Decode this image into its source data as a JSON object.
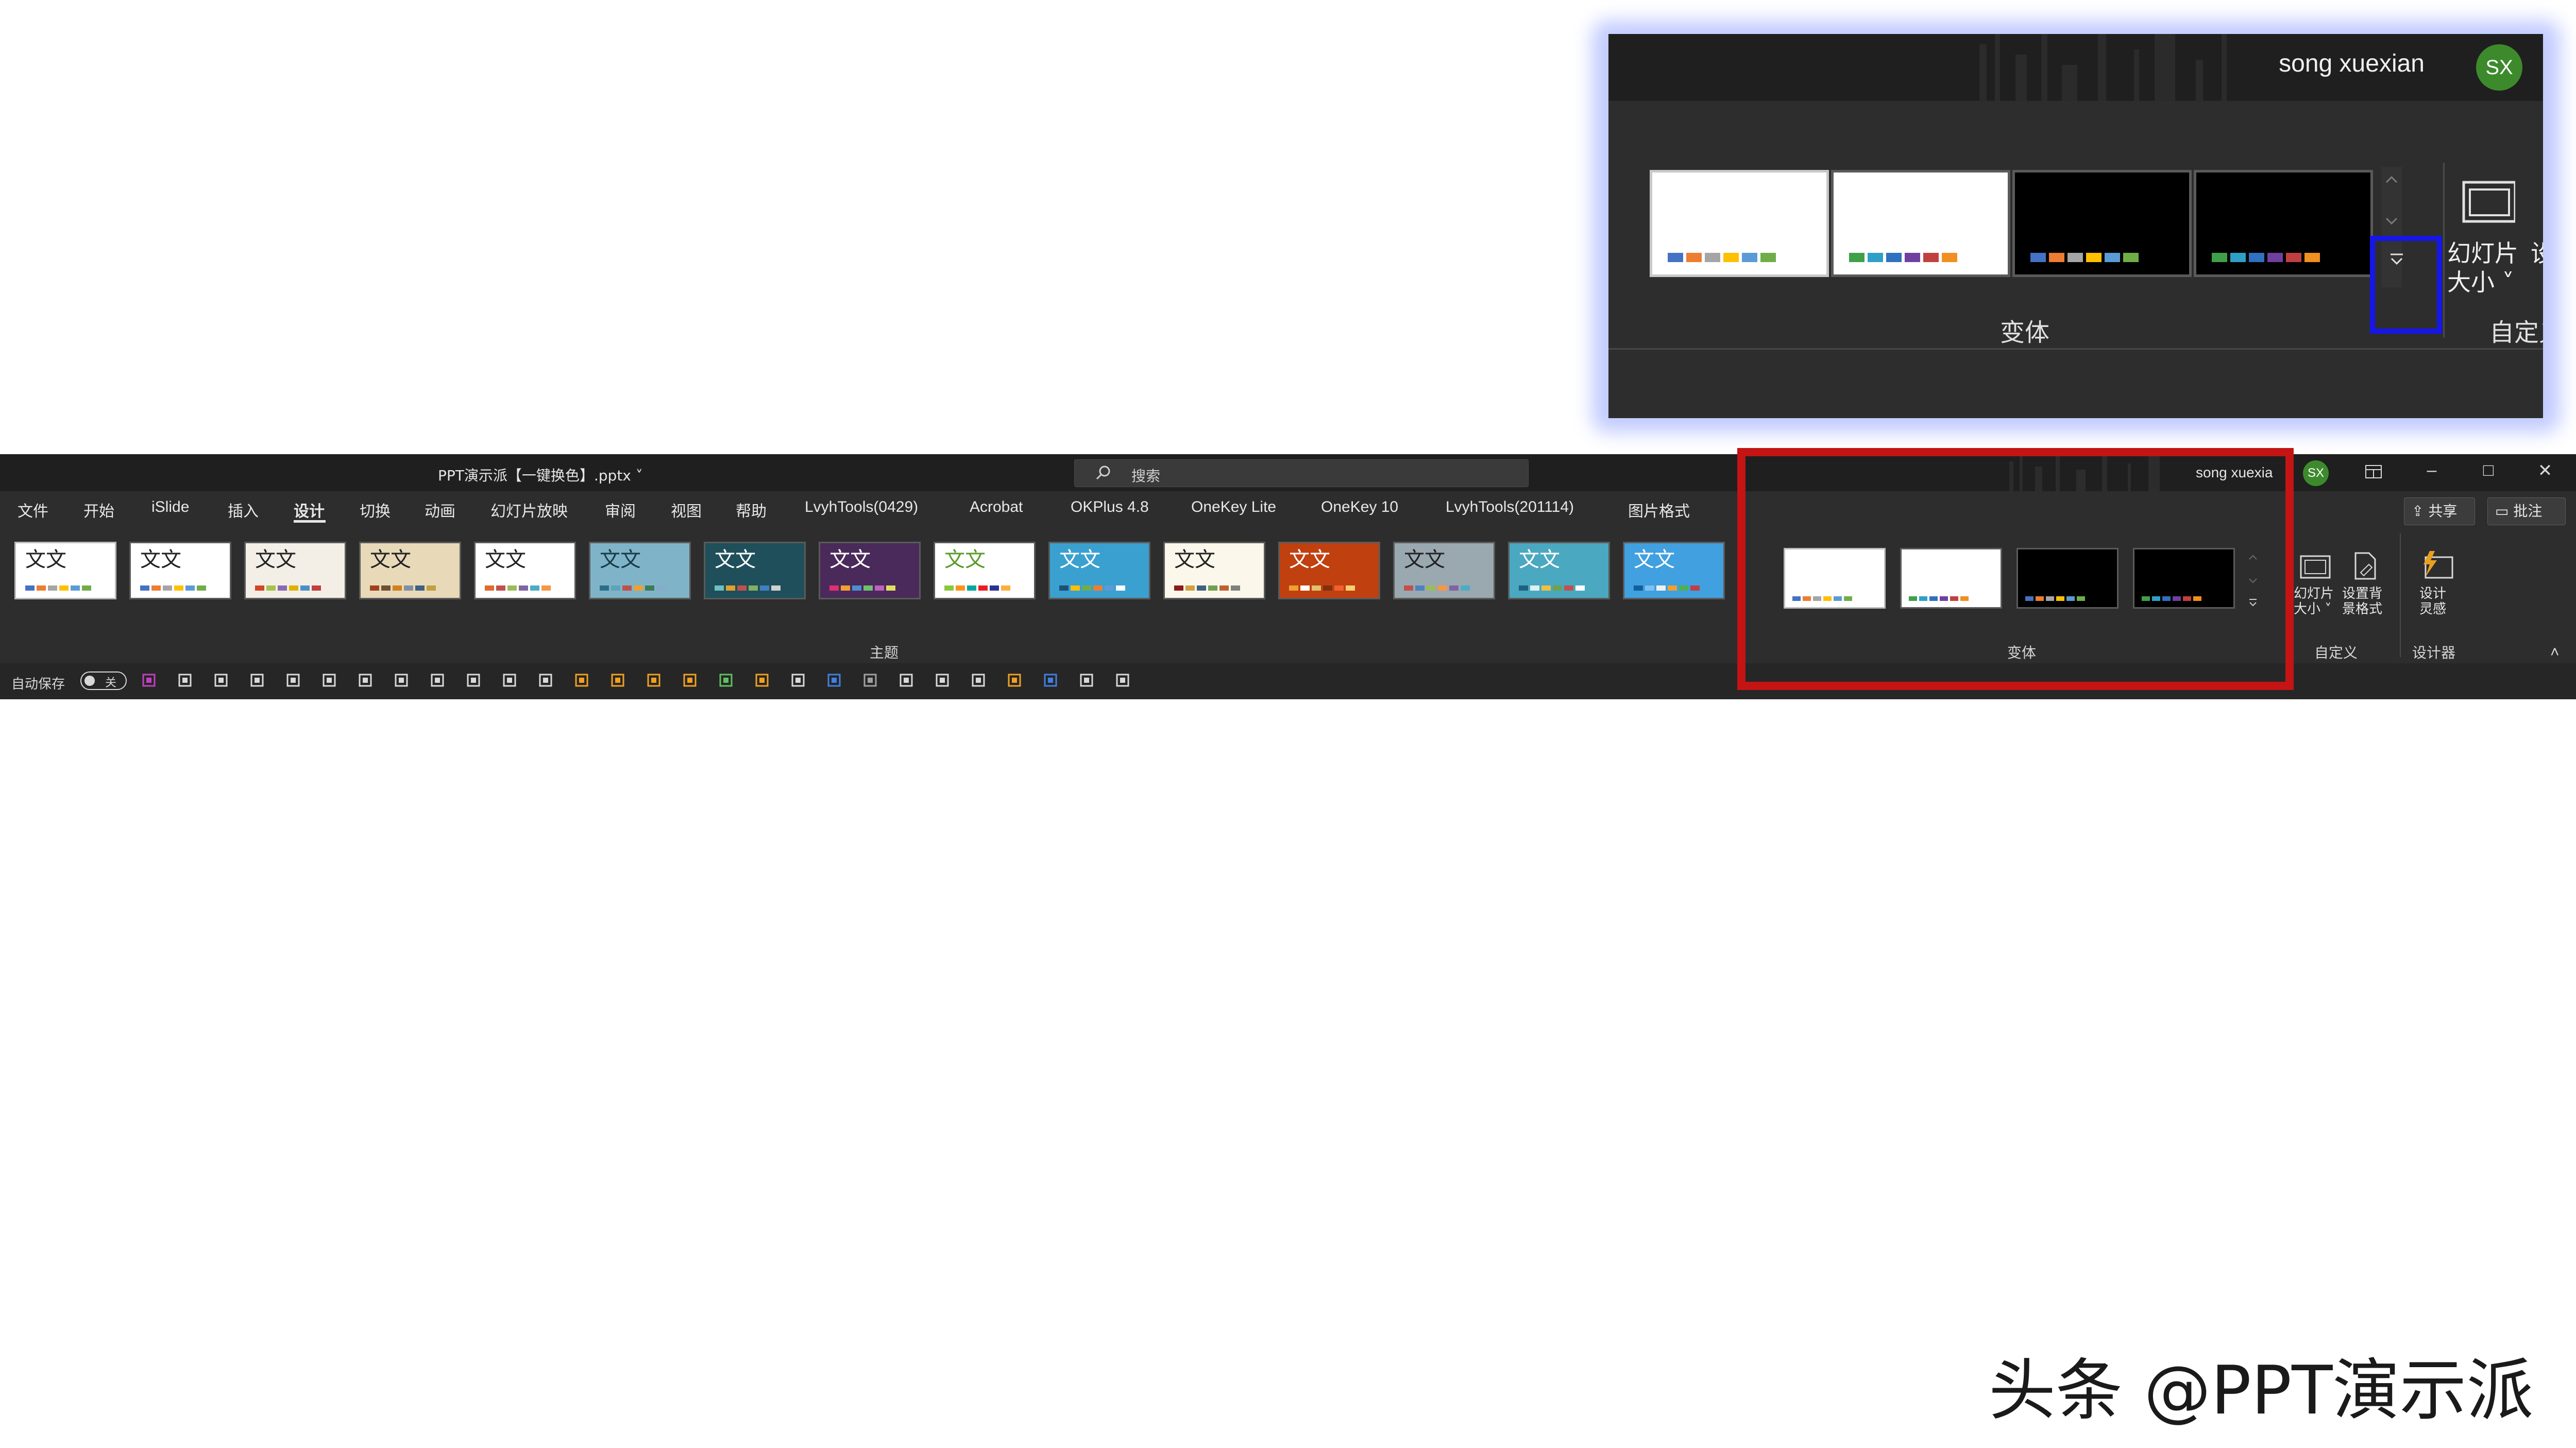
{
  "zoom_inset": {
    "user_name": "song xuexian",
    "avatar_initials": "SX",
    "variants_label": "变体",
    "slide_size_label": "幻灯片大小",
    "slide_size_line2": "大小",
    "custom_group_label": "自定义",
    "cut_text_right": "设"
  },
  "title_bar": {
    "doc_title": "PPT演示派【一键换色】.pptx",
    "search_placeholder": "搜索",
    "user_name": "song xuexia",
    "avatar_initials": "SX"
  },
  "tabs": [
    {
      "label": "文件"
    },
    {
      "label": "开始"
    },
    {
      "label": "iSlide"
    },
    {
      "label": "插入"
    },
    {
      "label": "设计"
    },
    {
      "label": "切换"
    },
    {
      "label": "动画"
    },
    {
      "label": "幻灯片放映"
    },
    {
      "label": "审阅"
    },
    {
      "label": "视图"
    },
    {
      "label": "帮助"
    },
    {
      "label": "LvyhTools(0429)"
    },
    {
      "label": "Acrobat"
    },
    {
      "label": "OKPlus 4.8"
    },
    {
      "label": "OneKey Lite"
    },
    {
      "label": "OneKey 10"
    },
    {
      "label": "LvyhTools(201114)"
    },
    {
      "label": "图片格式"
    }
  ],
  "share_button": "共享",
  "comments_button": "批注",
  "themes": {
    "group_label": "主题",
    "thumb_text": "文文",
    "items": [
      {
        "bg": "#ffffff",
        "fg": "#222222",
        "sw": [
          "#4472c4",
          "#ed7d31",
          "#a5a5a5",
          "#ffc000",
          "#5b9bd5",
          "#70ad47"
        ]
      },
      {
        "bg": "#ffffff",
        "fg": "#222222",
        "sw": [
          "#4472c4",
          "#ed7d31",
          "#a5a5a5",
          "#ffc000",
          "#5b9bd5",
          "#70ad47"
        ]
      },
      {
        "bg": "#f3efe6",
        "fg": "#222222",
        "sw": [
          "#d24726",
          "#a5c249",
          "#8b6ab0",
          "#e0b000",
          "#4a90c8",
          "#c04040"
        ]
      },
      {
        "bg": "#e8d9b8",
        "fg": "#222222",
        "sw": [
          "#a04020",
          "#705030",
          "#d08020",
          "#8090a0",
          "#406080",
          "#c0a040"
        ]
      },
      {
        "bg": "#ffffff",
        "fg": "#222222",
        "sw": [
          "#e0692c",
          "#c0504d",
          "#9bbb59",
          "#8064a2",
          "#4bacc6",
          "#f79646"
        ]
      },
      {
        "bg": "#7fb4c8",
        "fg": "#1a3a4a",
        "sw": [
          "#2a6f8a",
          "#5fa3b8",
          "#c0504d",
          "#f0a030",
          "#3d7a5a",
          "#88aacc"
        ]
      },
      {
        "bg": "#1f4f5a",
        "fg": "#ffffff",
        "sw": [
          "#6fc0c0",
          "#e0a030",
          "#c05050",
          "#80b060",
          "#4080c0",
          "#d0d0d0"
        ]
      },
      {
        "bg": "#4a2a5a",
        "fg": "#ffffff",
        "sw": [
          "#e03070",
          "#f0a030",
          "#4a90d0",
          "#70c070",
          "#c060c0",
          "#e0e060"
        ]
      },
      {
        "bg": "#ffffff",
        "fg": "#5a9a2a",
        "sw": [
          "#8cc63f",
          "#f7941d",
          "#00a99d",
          "#ed1c24",
          "#2e3192",
          "#fbb03b"
        ]
      },
      {
        "bg": "#3aa0d0",
        "fg": "#ffffff",
        "sw": [
          "#1f4e79",
          "#ffc000",
          "#70ad47",
          "#ed7d31",
          "#5b9bd5",
          "#ffffff"
        ]
      },
      {
        "bg": "#fbf7ea",
        "fg": "#222222",
        "sw": [
          "#8b1a1a",
          "#d0a040",
          "#406080",
          "#70a050",
          "#c06030",
          "#808080"
        ]
      },
      {
        "bg": "#c04010",
        "fg": "#ffffff",
        "sw": [
          "#f0a030",
          "#ffffff",
          "#e0c070",
          "#803010",
          "#f06030",
          "#f8d070"
        ]
      },
      {
        "bg": "#9aa8b0",
        "fg": "#222222",
        "sw": [
          "#c0504d",
          "#4f81bd",
          "#9bbb59",
          "#f79646",
          "#8064a2",
          "#4bacc6"
        ]
      },
      {
        "bg": "#4aa8c0",
        "fg": "#ffffff",
        "sw": [
          "#1f6080",
          "#e0f0f0",
          "#f0c040",
          "#70a050",
          "#c05050",
          "#ffffff"
        ]
      },
      {
        "bg": "#40a0e0",
        "fg": "#ffffff",
        "sw": [
          "#1060a0",
          "#80c0f0",
          "#f0f0f0",
          "#f0a030",
          "#50b050",
          "#c04040"
        ]
      }
    ]
  },
  "variants": {
    "group_label": "变体",
    "items": [
      {
        "bg": "#ffffff",
        "sw": [
          "#4472c4",
          "#ed7d31",
          "#a5a5a5",
          "#ffc000",
          "#5b9bd5",
          "#70ad47"
        ]
      },
      {
        "bg": "#ffffff",
        "sw": [
          "#3fa04a",
          "#2ea0c8",
          "#3070c0",
          "#7040a0",
          "#c04040",
          "#f09020"
        ]
      },
      {
        "bg": "#000000",
        "sw": [
          "#4472c4",
          "#ed7d31",
          "#a5a5a5",
          "#ffc000",
          "#5b9bd5",
          "#70ad47"
        ]
      },
      {
        "bg": "#000000",
        "sw": [
          "#3fa04a",
          "#2ea0c8",
          "#3070c0",
          "#7040a0",
          "#c04040",
          "#f09020"
        ]
      }
    ]
  },
  "customize": {
    "slide_size": "幻灯片",
    "slide_size_2": "大小",
    "format_bg": "设置背",
    "format_bg_2": "景格式",
    "group_label": "自定义"
  },
  "designer": {
    "btn_line1": "设计",
    "btn_line2": "灵感",
    "group_label": "设计器"
  },
  "qat": {
    "autosave_label": "自动保存",
    "autosave_state": "关"
  },
  "watermark": "头条 @PPT演示派"
}
